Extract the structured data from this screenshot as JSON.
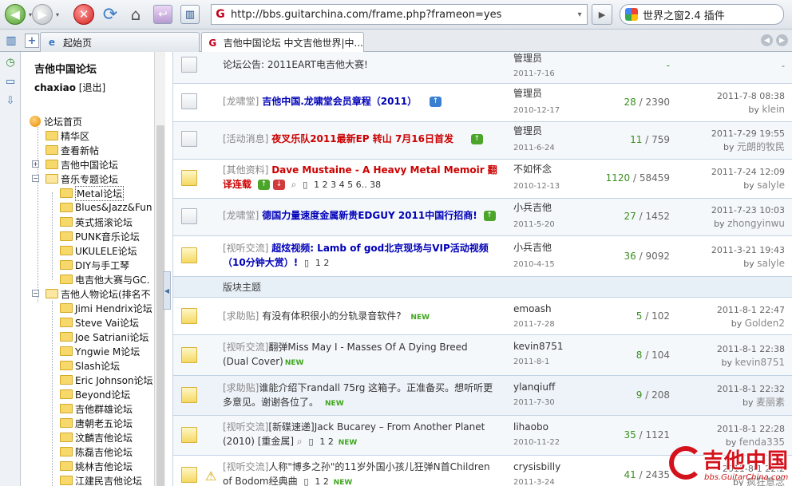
{
  "toolbar": {
    "url": "http://bbs.guitarchina.com/frame.php?frameon=yes",
    "search_text": "世界之窗2.4 插件"
  },
  "tabs": [
    {
      "label": "起始页"
    },
    {
      "label": "吉他中国论坛 中文吉他世界|中..."
    }
  ],
  "sidebar": {
    "title": "吉他中国论坛",
    "user": "chaxiao",
    "logout": "[退出]",
    "tree": [
      {
        "label": "论坛首页"
      },
      {
        "label": "精华区"
      },
      {
        "label": "查看新帖"
      },
      {
        "label": "吉他中国论坛"
      },
      {
        "label": "音乐专题论坛"
      },
      {
        "label": "Metal论坛"
      },
      {
        "label": "Blues&Jazz&Fun"
      },
      {
        "label": "英式摇滚论坛"
      },
      {
        "label": "PUNK音乐论坛"
      },
      {
        "label": "UKULELE论坛"
      },
      {
        "label": "DIY与手工琴"
      },
      {
        "label": "电吉他大赛与GC."
      },
      {
        "label": "吉他人物论坛(排名不"
      },
      {
        "label": "Jimi Hendrix论坛"
      },
      {
        "label": "Steve Vai论坛"
      },
      {
        "label": "Joe Satriani论坛"
      },
      {
        "label": "Yngwie M论坛"
      },
      {
        "label": "Slash论坛"
      },
      {
        "label": "Eric Johnson论坛"
      },
      {
        "label": "Beyond论坛"
      },
      {
        "label": "吉他群雄论坛"
      },
      {
        "label": "唐朝老五论坛"
      },
      {
        "label": "汶麟吉他论坛"
      },
      {
        "label": "陈磊吉他论坛"
      },
      {
        "label": "姚林吉他论坛"
      },
      {
        "label": "江建民吉他论坛"
      }
    ]
  },
  "threads": [
    {
      "type": "",
      "title": "论坛公告: 2011EART电吉他大赛!",
      "author": "管理员",
      "date": "2011-7-16",
      "replies": "-",
      "views": "",
      "last_time": "-",
      "last_by": ""
    },
    {
      "type": "[龙啸堂]",
      "title": "吉他中国.龙啸堂会员章程（2011）",
      "author": "管理员",
      "date": "2010-12-17",
      "replies": "28",
      "views": "2390",
      "last_time": "2011-7-8 08:38",
      "last_by": "klein"
    },
    {
      "type": "[活动消息]",
      "title": "夜叉乐队2011最新EP 转山 7月16日首发",
      "author": "管理员",
      "date": "2011-6-24",
      "replies": "11",
      "views": "759",
      "last_time": "2011-7-29 19:55",
      "last_by": "元朗的牧民"
    },
    {
      "type": "[其他资料]",
      "title": "Dave Mustaine - A Heavy Metal Memoir 翻译连载",
      "author": "不如怀念",
      "date": "2010-12-13",
      "replies": "1120",
      "views": "58459",
      "last_time": "2011-7-24 12:09",
      "last_by": "salyle",
      "pages": "1 2 3 4 5 6.. 38"
    },
    {
      "type": "[龙啸堂]",
      "title": "德国力量速度金属新贵EDGUY 2011中国行招商!",
      "author": "小兵吉他",
      "date": "2011-5-20",
      "replies": "27",
      "views": "1452",
      "last_time": "2011-7-23 10:03",
      "last_by": "zhongyinwu"
    },
    {
      "type": "[视听交流]",
      "title": "超炫视频: Lamb of god北京现场与VIP活动视频（10分钟大赏）!",
      "author": "小兵吉他",
      "date": "2010-4-15",
      "replies": "36",
      "views": "9092",
      "last_time": "2011-3-21 19:43",
      "last_by": "salyle",
      "pages": "1 2"
    }
  ],
  "section_label": "版块主题",
  "topics": [
    {
      "type": "[求助贴]",
      "title": "有没有体积很小的分轨录音软件?",
      "new": "NEW",
      "author": "emoash",
      "date": "2011-7-28",
      "replies": "5",
      "views": "102",
      "last_time": "2011-8-1 22:47",
      "last_by": "Golden2"
    },
    {
      "type": "[视听交流]",
      "title": "翻弹Miss May I - Masses Of A Dying Breed (Dual Cover)",
      "new": "NEW",
      "author": "kevin8751",
      "date": "2011-8-1",
      "replies": "8",
      "views": "104",
      "last_time": "2011-8-1 22:38",
      "last_by": "kevin8751"
    },
    {
      "type": "[求助贴]",
      "title": "谁能介绍下randall 75rg 这箱子。正准备买。想听听更多意见。谢谢各位了。",
      "new": "NEW",
      "author": "ylanqiuff",
      "date": "2011-7-30",
      "replies": "9",
      "views": "208",
      "last_time": "2011-8-1 22:32",
      "last_by": "麦丽素"
    },
    {
      "type": "[视听交流]",
      "title": "[新碟速递]Jack Bucarey – From Another Planet (2010) [重金属]",
      "new": "NEW",
      "author": "lihaobo",
      "date": "2010-11-22",
      "replies": "35",
      "views": "1121",
      "last_time": "2011-8-1 22:28",
      "last_by": "fenda335",
      "pages": "1 2"
    },
    {
      "type": "[视听交流]",
      "title": "人称\"博多之孙\"的11岁外国小孩儿狂弹N首Children of Bodom经典曲",
      "new": "NEW",
      "author": "crysisbilly",
      "date": "2011-3-24",
      "replies": "41",
      "views": "2435",
      "last_time": "2011-8-1 22:2",
      "last_by": "疯狂意念",
      "pages": "1 2"
    }
  ],
  "watermark": {
    "big": "吉他中国",
    "small": "bbs.GuitarChina.com"
  }
}
